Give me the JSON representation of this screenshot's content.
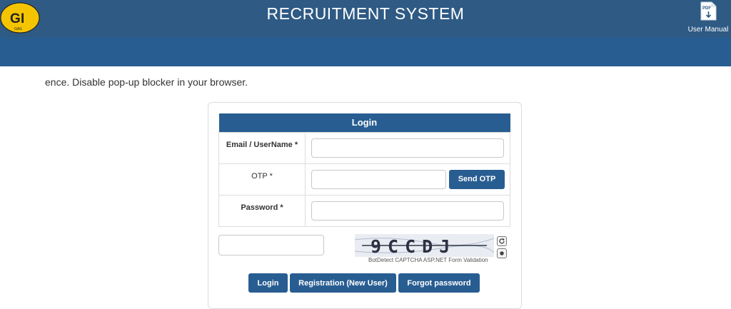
{
  "header": {
    "title": "RECRUITMENT SYSTEM",
    "logo_text": "GAIL",
    "user_manual_label": "User Manual",
    "user_manual_icon": "pdf-download-icon",
    "pdf_badge": "PDF"
  },
  "notice": "ence. Disable pop-up blocker in your browser.",
  "login": {
    "heading": "Login",
    "email_label": "Email / UserName *",
    "email_value": "",
    "otp_label": "OTP *",
    "otp_value": "",
    "send_otp_label": "Send OTP",
    "password_label": "Password *",
    "password_value": ""
  },
  "captcha": {
    "input_value": "",
    "image_text": "9CCDJ",
    "caption": "BotDetect CAPTCHA ASP.NET Form Validation",
    "reload_icon": "reload-icon",
    "sound_icon": "sound-icon"
  },
  "actions": {
    "login_label": "Login",
    "registration_label": "Registration (New User)",
    "forgot_label": "Forgot password"
  },
  "colors": {
    "header": "#2e5a84",
    "accent": "#285d91",
    "logo_yellow": "#f5c400"
  }
}
